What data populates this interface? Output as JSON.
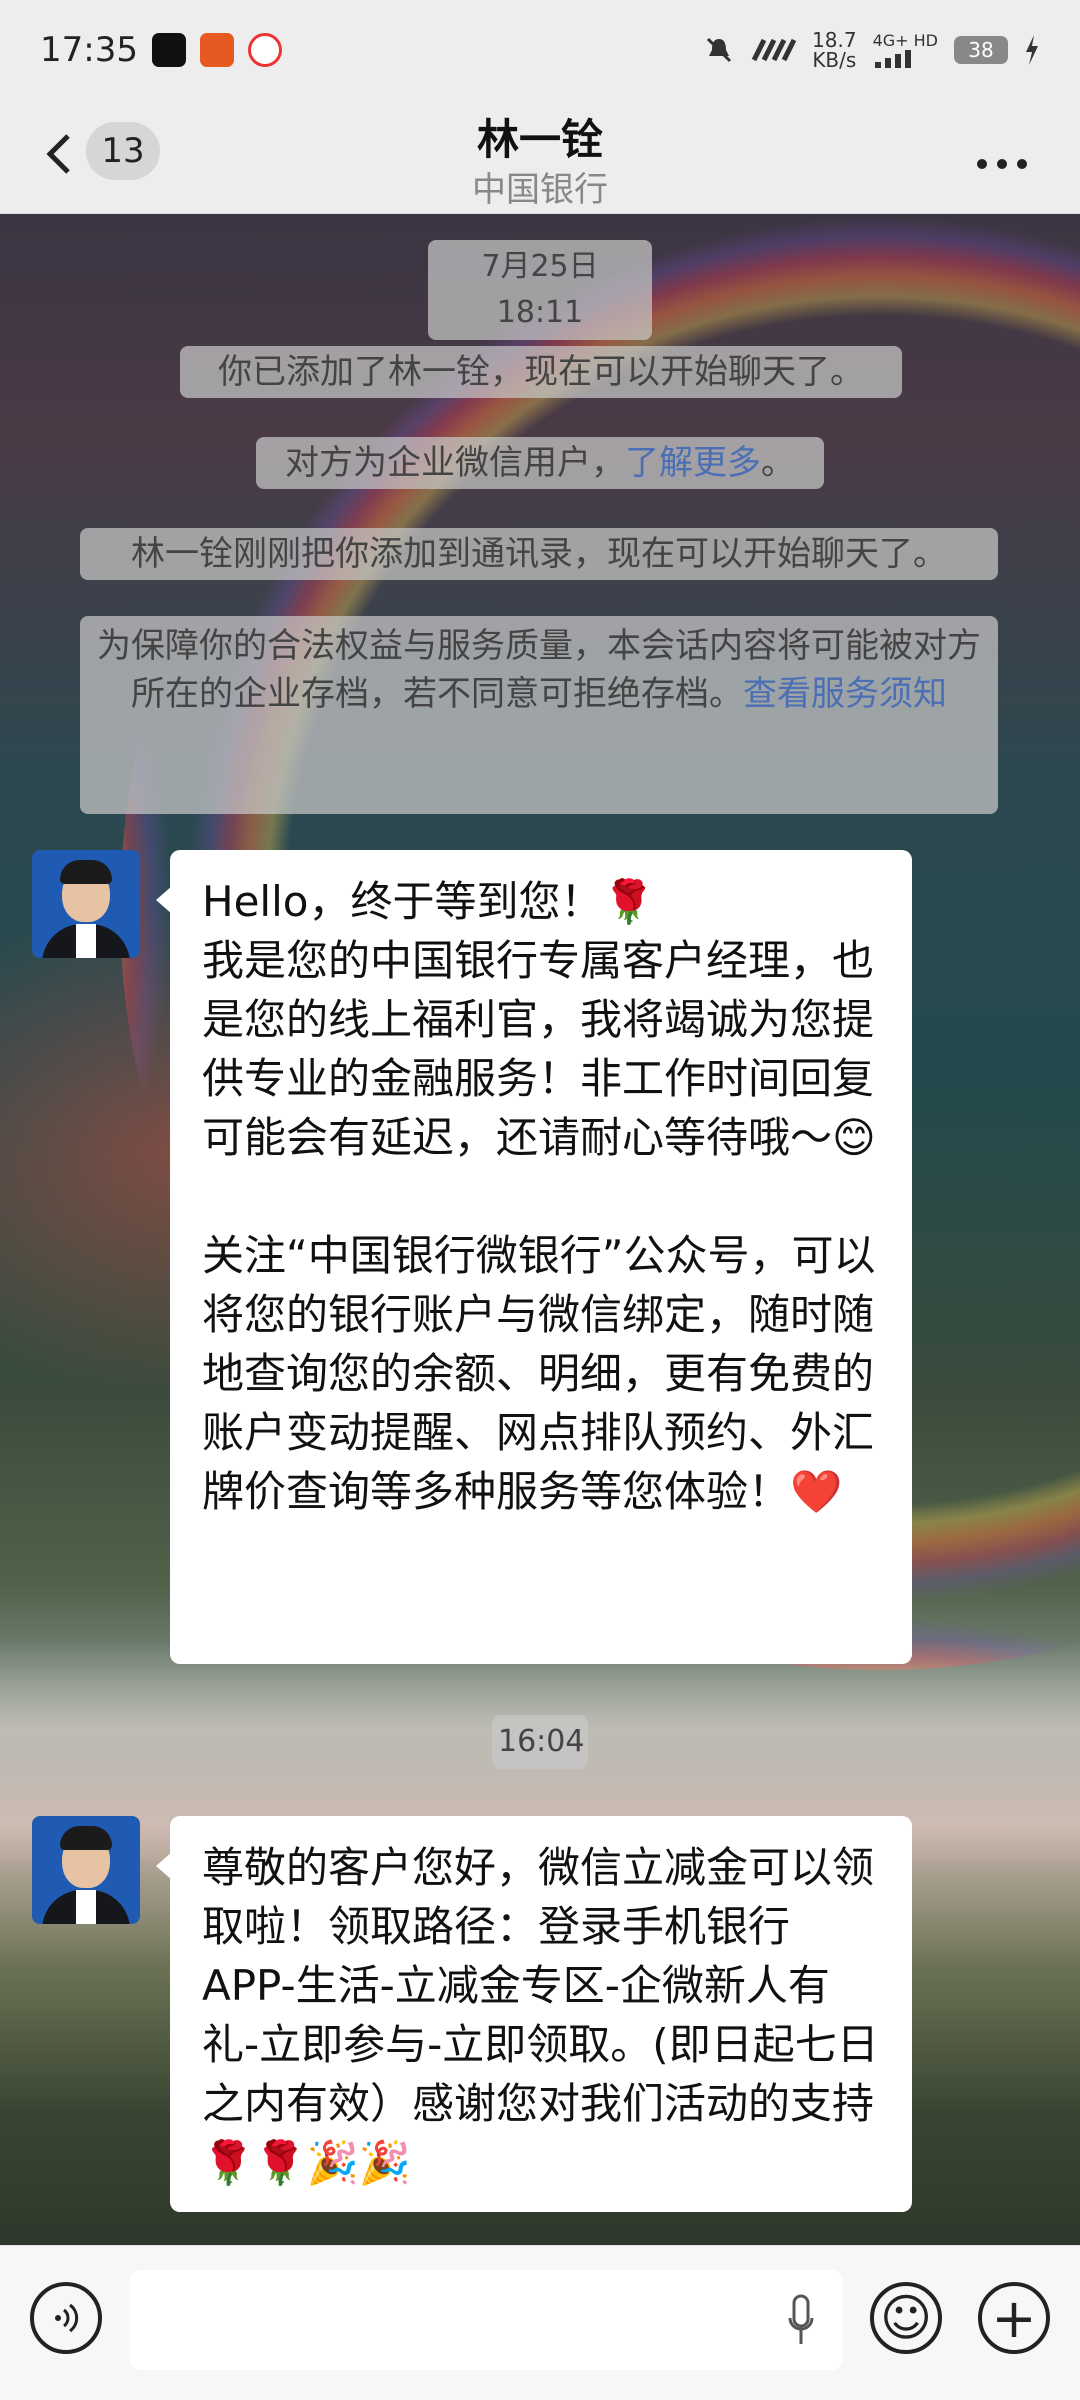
{
  "status_bar": {
    "time": "17:35",
    "net_speed_value": "18.7",
    "net_speed_unit": "KB/s",
    "network_label": "4G+ HD",
    "battery": "38"
  },
  "header": {
    "back_count": "13",
    "title": "林一铨",
    "subtitle": "中国银行"
  },
  "system_messages": {
    "timestamp_1": "7月25日 18:11",
    "added": "你已添加了林一铨，现在可以开始聊天了。",
    "enterprise_prefix": "对方为企业微信用户，",
    "enterprise_link": "了解更多",
    "enterprise_suffix": "。",
    "contact_added": "林一铨刚刚把你添加到通讯录，现在可以开始聊天了。",
    "archive_text": "为保障你的合法权益与服务质量，本会话内容将可能被对方所在的企业存档，若不同意可拒绝存档。",
    "archive_link": "查看服务须知",
    "timestamp_2": "16:04"
  },
  "messages": [
    {
      "sender": "林一铨",
      "text": "Hello，终于等到您！🌹\n我是您的中国银行专属客户经理，也是您的线上福利官，我将竭诚为您提供专业的金融服务！非工作时间回复可能会有延迟，还请耐心等待哦～😊\n\n关注“中国银行微银行”公众号，可以将您的银行账户与微信绑定，随时随地查询您的余额、明细，更有免费的账户变动提醒、网点排队预约、外汇牌价查询等多种服务等您体验！❤️"
    },
    {
      "sender": "林一铨",
      "text": "尊敬的客户您好，微信立减金可以领取啦！领取路径：登录手机银行APP-生活-立减金专区-企微新人有礼-立即参与-立即领取。(即日起七日之内有效）感谢您对我们活动的支持🌹🌹🎉🎉"
    }
  ],
  "input_bar": {
    "voice_icon": "voice-icon",
    "mic_icon": "mic-icon",
    "emoji_icon": "emoji-icon",
    "plus_icon": "plus-icon",
    "emoji_glyph": "☺",
    "plus_glyph": "+"
  }
}
